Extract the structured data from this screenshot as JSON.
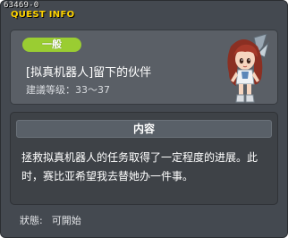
{
  "window": {
    "quest_id": "63469-0",
    "title": "QUEST INFO"
  },
  "quest": {
    "category": "一般",
    "name": "[拟真机器人]留下的伙伴",
    "level_label": "建議等级：",
    "level_range": "33～37"
  },
  "content": {
    "header": "内容",
    "description": "拯救拟真机器人的任务取得了一定程度的进展。此时，赛比亚希望我去替她办一件事。"
  },
  "status": {
    "label": "狀態:",
    "value": "可開始"
  },
  "colors": {
    "window_bg": "#444950",
    "title_accent": "#ffd400",
    "badge": "#9acd32"
  },
  "icons": {
    "npc": "npc-portrait-icon"
  }
}
